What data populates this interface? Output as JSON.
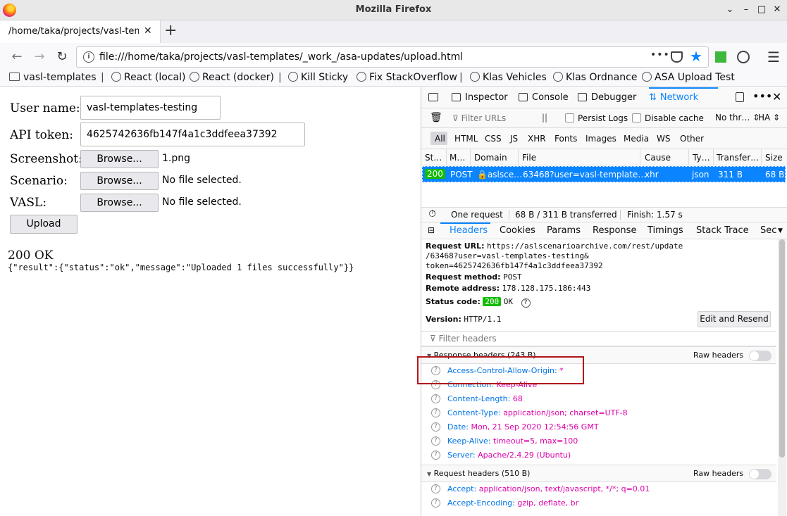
{
  "window": {
    "title": "Mozilla Firefox"
  },
  "tab": {
    "title": "/home/taka/projects/vasl-templates/_work_/asa-updates/upload.html"
  },
  "navbar": {
    "url": "file:///home/taka/projects/vasl-templates/_work_/asa-updates/upload.html",
    "page_actions": "•••"
  },
  "bookmarks": [
    {
      "label": "vasl-templates",
      "icon": "folder-icon"
    },
    {
      "label": "React (local)",
      "icon": "globe-icon"
    },
    {
      "label": "React (docker)",
      "icon": "globe-icon"
    },
    {
      "label": "Kill Sticky",
      "icon": "globe-icon"
    },
    {
      "label": "Fix StackOverflow",
      "icon": "globe-icon"
    },
    {
      "label": "Klas Vehicles",
      "icon": "globe-icon"
    },
    {
      "label": "Klas Ordnance",
      "icon": "globe-icon"
    },
    {
      "label": "ASA Upload Test",
      "icon": "globe-icon"
    }
  ],
  "form": {
    "username_label": "User name:",
    "username_value": "vasl-templates-testing",
    "token_label": "API token:",
    "token_value": "4625742636fb147f4a1c3ddfeea37392",
    "screenshot_label": "Screenshot:",
    "scenario_label": "Scenario:",
    "vasl_label": "VASL:",
    "browse_label": "Browse...",
    "screenshot_file": "1.png",
    "scenario_file": "No file selected.",
    "vasl_file": "No file selected.",
    "upload_label": "Upload"
  },
  "response": {
    "status": "200 OK",
    "body": "{\"result\":{\"status\":\"ok\",\"message\":\"Uploaded 1 files successfully\"}}"
  },
  "devtools": {
    "tabs": [
      "Inspector",
      "Console",
      "Debugger",
      "Network"
    ],
    "selected_tab": "Network",
    "filter_placeholder": "Filter URLs",
    "pause": "||",
    "persist_logs": "Persist Logs",
    "disable_cache": "Disable cache",
    "throttle": "No thr…",
    "har": "HA",
    "types": [
      "All",
      "HTML",
      "CSS",
      "JS",
      "XHR",
      "Fonts",
      "Images",
      "Media",
      "WS",
      "Other"
    ],
    "columns": [
      "St…",
      "M…",
      "Domain",
      "File",
      "Cause",
      "Ty…",
      "Transfer…",
      "Size"
    ],
    "request": {
      "status": "200",
      "method": "POST",
      "domain": "aslsce…",
      "file": "63468?user=vasl-template…",
      "cause": "xhr",
      "type": "json",
      "transferred": "311 B",
      "size": "68 B"
    },
    "summary": {
      "count": "One request",
      "transferred": "68 B / 311 B transferred",
      "finish": "Finish: 1.57 s"
    },
    "detail_tabs": [
      "Headers",
      "Cookies",
      "Params",
      "Response",
      "Timings",
      "Stack Trace",
      "Sec"
    ],
    "headers": {
      "request_url_label": "Request URL:",
      "request_url_1": "https://aslscenarioarchive.com/rest/update",
      "request_url_2": "/63468?user=vasl-templates-testing&",
      "request_url_3": "token=4625742636fb147f4a1c3ddfeea37392",
      "method_label": "Request method:",
      "method_value": "POST",
      "remote_label": "Remote address:",
      "remote_value": "178.128.175.186:443",
      "status_label": "Status code:",
      "status_code": "200",
      "status_text": "OK",
      "version_label": "Version:",
      "version_value": "HTTP/1.1",
      "edit_resend": "Edit and Resend",
      "filter_headers": "Filter headers",
      "response_section": "Response headers (243 B)",
      "request_section": "Request headers (510 B)",
      "raw_headers": "Raw headers",
      "response_headers": [
        {
          "name": "Access-Control-Allow-Origin:",
          "value": "*"
        },
        {
          "name": "Connection:",
          "value": "Keep-Alive"
        },
        {
          "name": "Content-Length:",
          "value": "68"
        },
        {
          "name": "Content-Type:",
          "value": "application/json; charset=UTF-8"
        },
        {
          "name": "Date:",
          "value": "Mon, 21 Sep 2020 12:54:56 GMT"
        },
        {
          "name": "Keep-Alive:",
          "value": "timeout=5, max=100"
        },
        {
          "name": "Server:",
          "value": "Apache/2.4.29 (Ubuntu)"
        }
      ],
      "request_headers": [
        {
          "name": "Accept:",
          "value": "application/json, text/javascript, */*; q=0.01"
        },
        {
          "name": "Accept-Encoding:",
          "value": "gzip, deflate, br"
        }
      ]
    }
  },
  "colors": {
    "accent": "#0a84ff",
    "status_ok": "#12bc00",
    "highlight": "#b1161c",
    "header_name": "#0074e8",
    "header_value": "#dd00a9"
  }
}
